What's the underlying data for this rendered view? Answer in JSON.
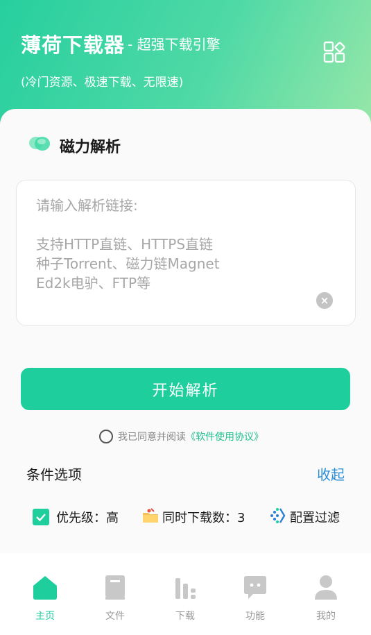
{
  "header": {
    "title": "薄荷下载器",
    "subtitle": "- 超强下载引擎",
    "description": "(冷门资源、极速下载、无限速)"
  },
  "section": {
    "title": "磁力解析"
  },
  "input": {
    "value": "",
    "placeholder": "请输入解析链接:\n\n支持HTTP直链、HTTPS直链\n种子Torrent、磁力链Magnet\nEd2k电驴、FTP等"
  },
  "start_button": {
    "label": "开始解析"
  },
  "agreement": {
    "text": "我已同意并阅读",
    "link": "《软件使用协议》"
  },
  "options": {
    "label": "条件选项",
    "collapse": "收起",
    "priority": "优先级：高",
    "concurrent": "同时下载数：3",
    "filter": "配置过滤"
  },
  "tabs": [
    {
      "label": "主页",
      "icon": "home-icon",
      "active": true
    },
    {
      "label": "文件",
      "icon": "book-icon",
      "active": false
    },
    {
      "label": "下载",
      "icon": "bar-chart-icon",
      "active": false
    },
    {
      "label": "功能",
      "icon": "chat-icon",
      "active": false
    },
    {
      "label": "我的",
      "icon": "user-icon",
      "active": false
    }
  ],
  "colors": {
    "accent": "#1ecf9d",
    "link": "#2a8fd6",
    "tab_inactive": "#c8c8c8"
  }
}
